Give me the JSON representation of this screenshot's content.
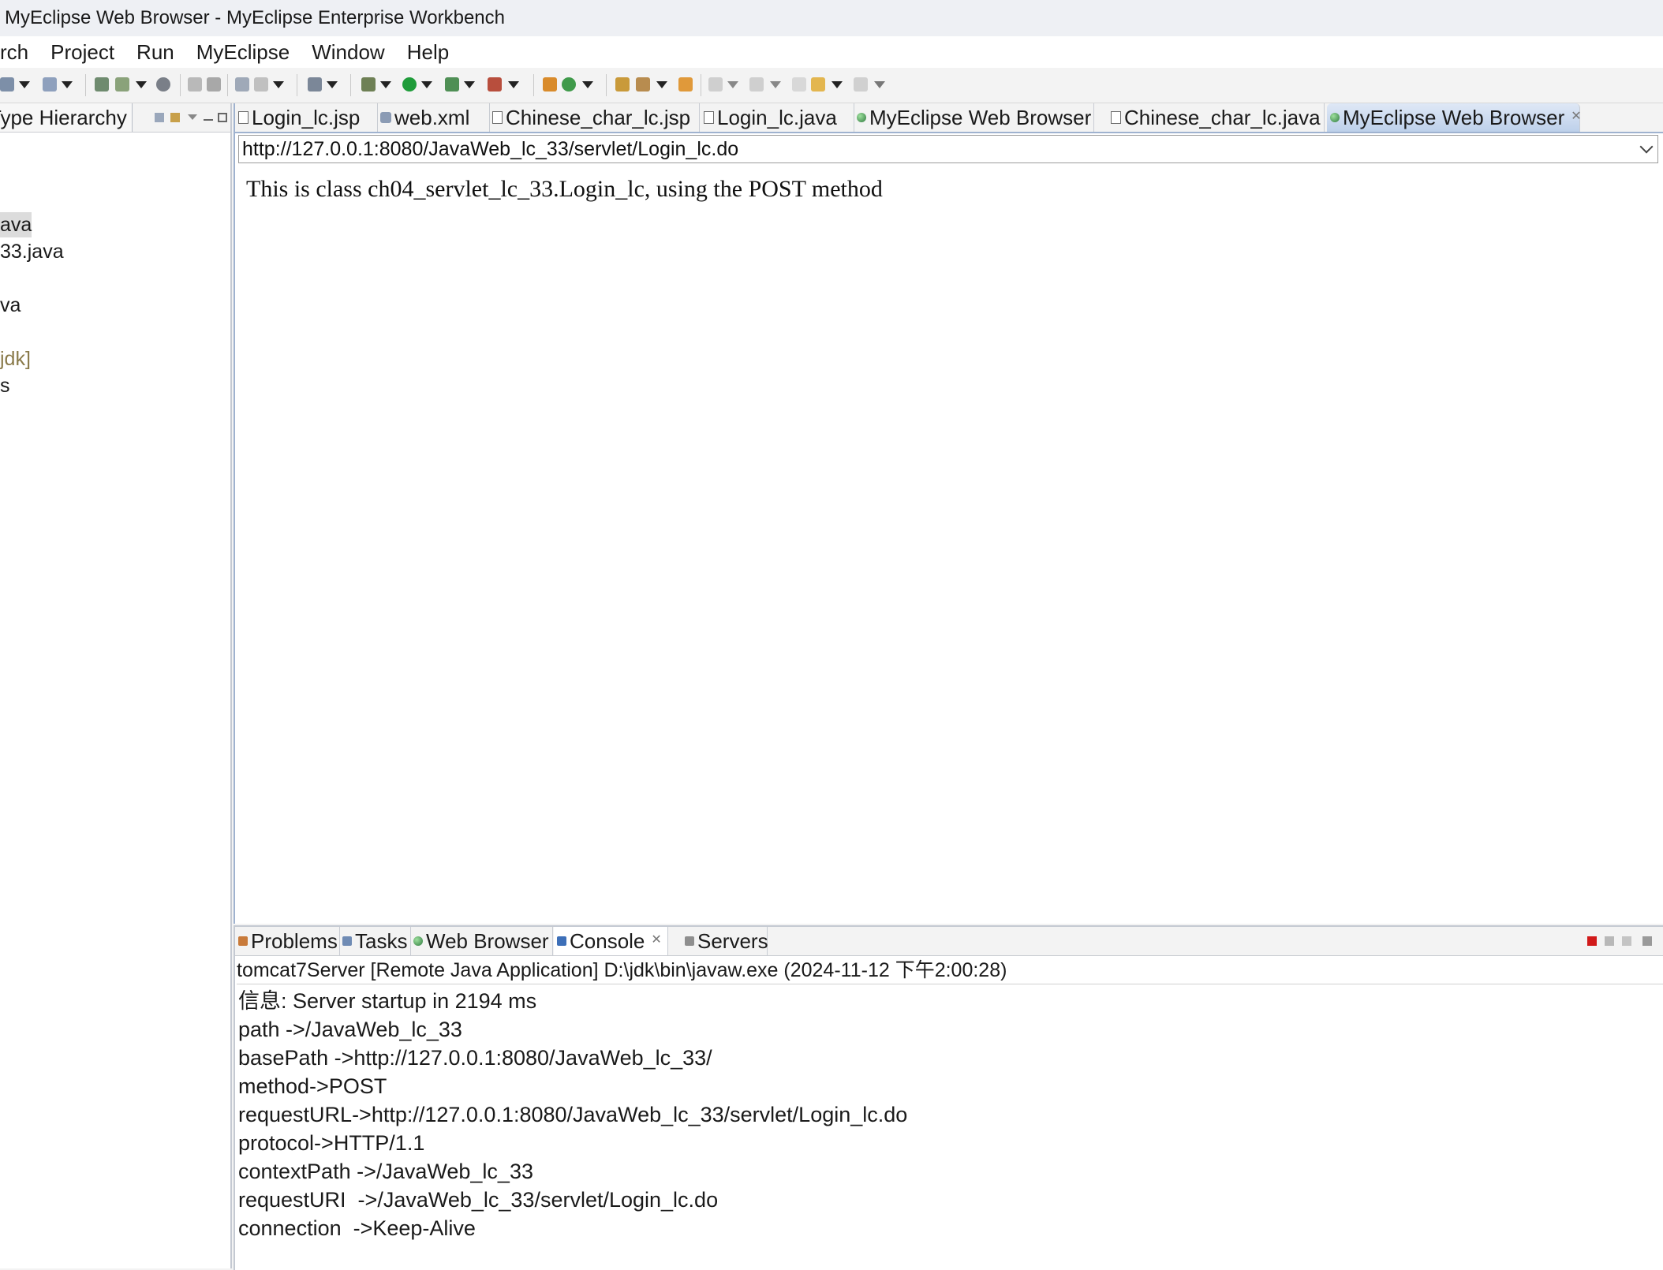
{
  "window": {
    "title": "MyEclipse Web Browser - MyEclipse Enterprise Workbench"
  },
  "menubar": {
    "items": [
      "rch",
      "Project",
      "Run",
      "MyEclipse",
      "Window",
      "Help"
    ]
  },
  "left_panel": {
    "tab_label": "Type Hierarchy",
    "tree_items": [
      {
        "text": "ava",
        "selected": true,
        "color": "#1a1a1a"
      },
      {
        "text": "33.java",
        "selected": false,
        "color": "#1a1a1a"
      },
      {
        "text": "va",
        "selected": false,
        "color": "#1a1a1a"
      },
      {
        "text": "jdk]",
        "selected": false,
        "color": "#8a7a4a"
      },
      {
        "text": "s",
        "selected": false,
        "color": "#1a1a1a"
      }
    ]
  },
  "editor": {
    "tabs": [
      {
        "label": "Login_lc.jsp",
        "icon": "jsp-file-icon"
      },
      {
        "label": "web.xml",
        "icon": "xml-file-icon"
      },
      {
        "label": "Chinese_char_lc.jsp",
        "icon": "jsp-file-icon"
      },
      {
        "label": "Login_lc.java",
        "icon": "java-file-icon"
      },
      {
        "label": "MyEclipse Web Browser",
        "icon": "browser-globe-icon"
      },
      {
        "label": "Chinese_char_lc.java",
        "icon": "java-file-icon"
      },
      {
        "label": "MyEclipse Web Browser",
        "icon": "browser-globe-icon",
        "active": true
      }
    ],
    "url": "http://127.0.0.1:8080/JavaWeb_lc_33/servlet/Login_lc.do",
    "page_text": "This is class ch04_servlet_lc_33.Login_lc, using the POST method"
  },
  "console": {
    "tabs": [
      {
        "label": "Problems",
        "icon": "problems-icon"
      },
      {
        "label": "Tasks",
        "icon": "tasks-icon"
      },
      {
        "label": "Web Browser",
        "icon": "browser-globe-icon"
      },
      {
        "label": "Console",
        "icon": "console-icon",
        "active": true
      },
      {
        "label": "Servers",
        "icon": "servers-icon"
      }
    ],
    "header": "tomcat7Server [Remote Java Application] D:\\jdk\\bin\\javaw.exe (2024-11-12 下午2:00:28)",
    "lines": [
      "信息: Server startup in 2194 ms",
      "path ->/JavaWeb_lc_33",
      "basePath ->http://127.0.0.1:8080/JavaWeb_lc_33/",
      "method->POST",
      "requestURL->http://127.0.0.1:8080/JavaWeb_lc_33/servlet/Login_lc.do",
      "protocol->HTTP/1.1",
      "contextPath ->/JavaWeb_lc_33",
      "requestURI  ->/JavaWeb_lc_33/servlet/Login_lc.do",
      "connection  ->Keep-Alive"
    ]
  },
  "colors": {
    "active_tab": "#bdd0ea",
    "terminate": "#d11a1a",
    "run": "#1f9c3a"
  }
}
